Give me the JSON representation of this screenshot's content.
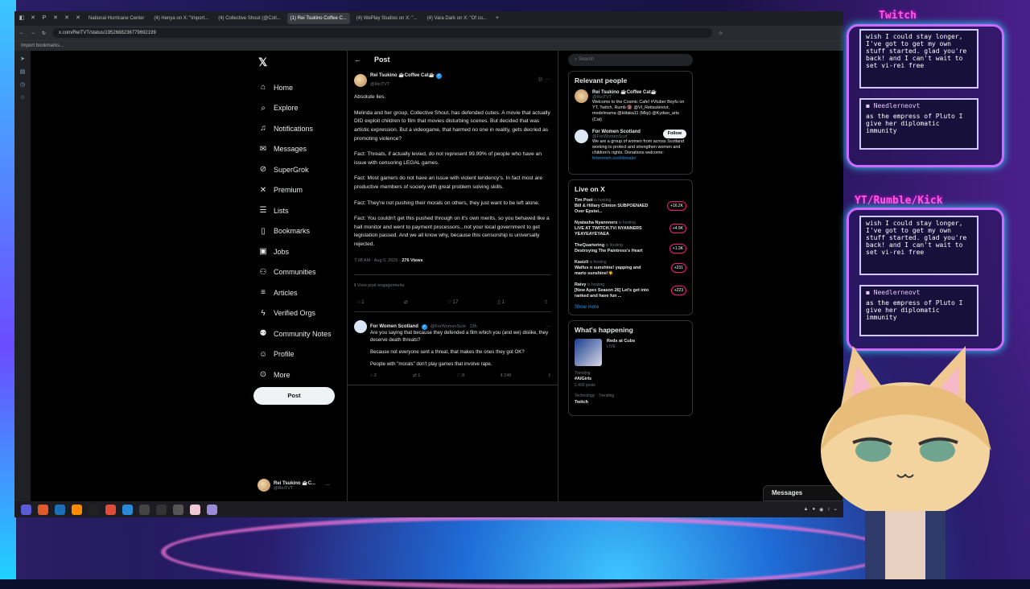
{
  "browser": {
    "tabs": [
      "National Hurricane Center",
      "(4) Henya on X: \"Import...",
      "(4) Collective Shout (@Coll...",
      "(1) Rei Tsukino Coffee C...",
      "(4) WePlay Studios on X: \"...",
      "(4) Vara Dark on X: \"Of co..."
    ],
    "url": "x.com/ReiTVT/status/1952688236779692199",
    "bookmarks": "Import bookmarks..."
  },
  "nav": {
    "items": [
      "Home",
      "Explore",
      "Notifications",
      "Messages",
      "SuperGrok",
      "Premium",
      "Lists",
      "Bookmarks",
      "Jobs",
      "Communities",
      "Articles",
      "Verified Orgs",
      "Community Notes",
      "Profile",
      "More"
    ],
    "post_button": "Post",
    "account_name": "Rei Tsukino ☕C...",
    "account_handle": "@ReiTVT"
  },
  "post": {
    "header": "Post",
    "author_name": "Rei Tsukino ☕Coffee Cat☕",
    "author_handle": "@ReiTVT",
    "paragraphs": [
      "Absolute lies.",
      "Melinda and her group, Collective Shout, has defended cuties. A movie that actually DID exploit children to film that movies disturbing scenes. But decided that was artistic expression. But a videogame, that harmed no one in reality, gets decried as promoting violence?",
      "Fact: Threats, if actually levied, do not represent 99.99% of people who have an issue with censoring LEGAL games.",
      "Fact: Most gamers do not have an issue with violent tendency's. In fact most are productive members of society with great problem solving skills.",
      "Fact: They're not pushing their morals on others, they just want to be left alone.",
      "Fact: You couldn't get this pushed through on it's own merits, so you behaved like a hall monitor and went to payment processors...not your local government to get legislation passed. And we all know why, because this censorship is universally rejected."
    ],
    "timestamp": "7:08 AM · Aug 5, 2025 · ",
    "views": "276 Views",
    "engagements": "View post engagements",
    "counts": {
      "reply": "1",
      "repost": "",
      "like": "17",
      "bookmark": "1"
    }
  },
  "reply": {
    "author_name": "For Women Scotland",
    "author_handle": "@ForWomenScot · 13h",
    "lines": [
      "Are you saying that because they defended a film which you (and we) dislike, they deserve death threats?",
      "Because not everyone sent a threat, that makes the ones they got OK?",
      "People with \"morals\" don't play games that involve rape."
    ],
    "counts": {
      "reply": "2",
      "repost": "1",
      "like": "8",
      "views": "249"
    }
  },
  "sidebar": {
    "search_placeholder": "Search",
    "relevant_title": "Relevant people",
    "people": [
      {
        "name": "Rei Tsukino ☕Coffee Cat☕",
        "handle": "@ReiTVT",
        "bio": "Welcome to the Cosmic Cafe! #Vtuber Boyfu on YT, Twitch, Rumb 🔞 @VI_Reitsukinovt, modelmama @kiitaka11 (Mkp) @Kydwo_arts (Cat)"
      },
      {
        "name": "For Women Scotland",
        "handle": "@ForWomenScot",
        "bio": "We are a group of women from across Scotland working to protect and strengthen women and children's rights. Donations welcome:",
        "link": "forwomen.scot/donate/",
        "follow": "Follow"
      }
    ],
    "live_title": "Live on X",
    "live": [
      {
        "host": "Tim Pool",
        "title": "Bill & Hillary Clinton SUBPOENAED Over Epstei...",
        "count": "+16.2K"
      },
      {
        "host": "Nyatasha Nyannners",
        "title": "LIVE AT TWITCH.TV/ NYANNERS YEAYEAYEYAEA",
        "count": "+4.9K"
      },
      {
        "host": "TheQuartering",
        "title": "Destroying The Paintress's Heart",
        "count": "+1.3K"
      },
      {
        "host": "Kasizli",
        "title": "Waifus n sunshine! yapping and mario sunshine!☀️",
        "count": "+231"
      },
      {
        "host": "Raivy",
        "title": "[New Apex Season 26] Let's get into ranked and have fun ...",
        "count": "+223"
      }
    ],
    "is_hosting": "is hosting",
    "show_more": "Show more",
    "happening_title": "What's happening",
    "trends": [
      {
        "title": "Reds at Cubs",
        "sub": "LIVE"
      },
      {
        "label": "Trending",
        "title": "#AIGirls",
        "sub": "2,402 posts"
      },
      {
        "label": "Technology · Trending",
        "title": "Twitch",
        "sub": ""
      }
    ],
    "messages": "Messages"
  },
  "overlay": {
    "twitch_title": "Twitch",
    "yt_title": "YT/Rumble/Kick",
    "top_msg": "wish I could stay longer, I've got to get my own stuff started. glad you're back! and I can't wait to set vi-rei free",
    "user": "Needlerneovt",
    "bottom_msg": "as the empress of Pluto I give her diplomatic immunity"
  }
}
